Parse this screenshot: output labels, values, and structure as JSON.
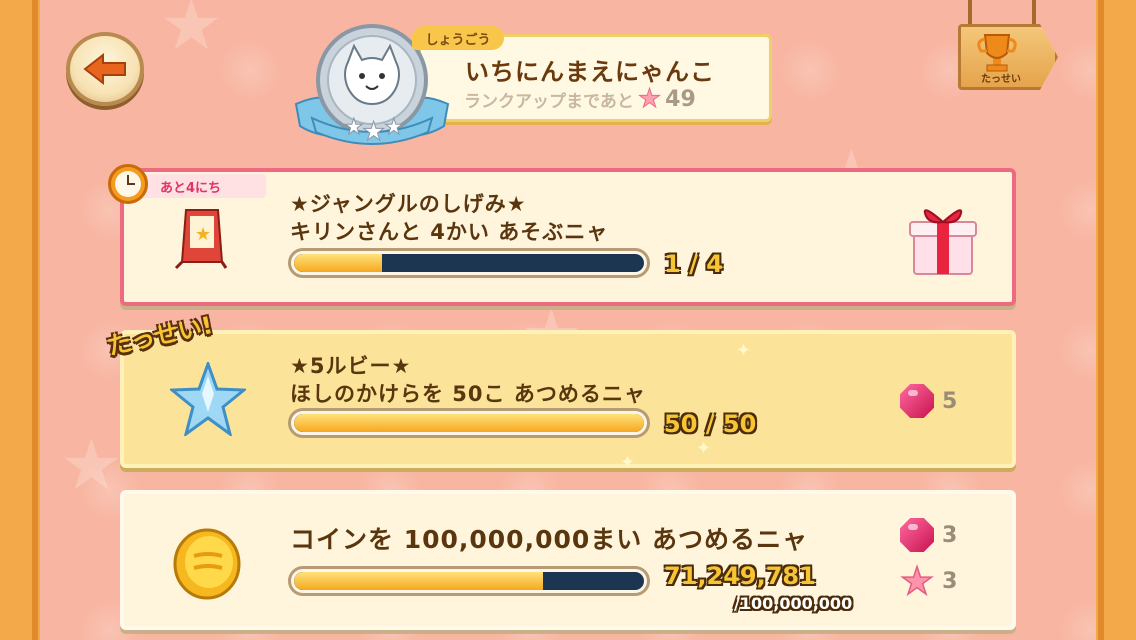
{
  "header": {
    "title_tag": "しょうごう",
    "title_name": "いちにんまえにゃんこ",
    "rank_up_label": "ランクアップまであと",
    "rank_up_remaining": "49",
    "achievement_sign_label": "たっせい"
  },
  "missions": [
    {
      "time_left": "あと4にち",
      "name": "★ジャングルのしげみ★",
      "description": "キリンさんと 4かい あそぶニャ",
      "progress_current": "1",
      "progress_separator": "/",
      "progress_total": "4",
      "progress_fraction": 0.25,
      "reward_icon": "gift-box-icon"
    },
    {
      "status_stamp": "たっせい!",
      "name": "★5ルビー★",
      "description": "ほしのかけらを 50こ あつめるニャ",
      "progress_current": "50",
      "progress_separator": "/",
      "progress_total": "50",
      "progress_fraction": 1.0,
      "rewards": [
        {
          "icon": "ruby-gem-icon",
          "amount": "5"
        }
      ]
    },
    {
      "description": "コインを 100,000,000まい あつめるニャ",
      "progress_current": "71,249,781",
      "progress_total": "/100,000,000",
      "progress_fraction": 0.712,
      "rewards": [
        {
          "icon": "ruby-gem-icon",
          "amount": "3"
        },
        {
          "icon": "pink-star-icon",
          "amount": "3"
        }
      ]
    }
  ],
  "colors": {
    "frame": "#f3a94a",
    "background": "#f8b6a2",
    "active_border": "#ee6a80",
    "completed_card": "#fbe39a",
    "count_text": "#f7c533"
  }
}
